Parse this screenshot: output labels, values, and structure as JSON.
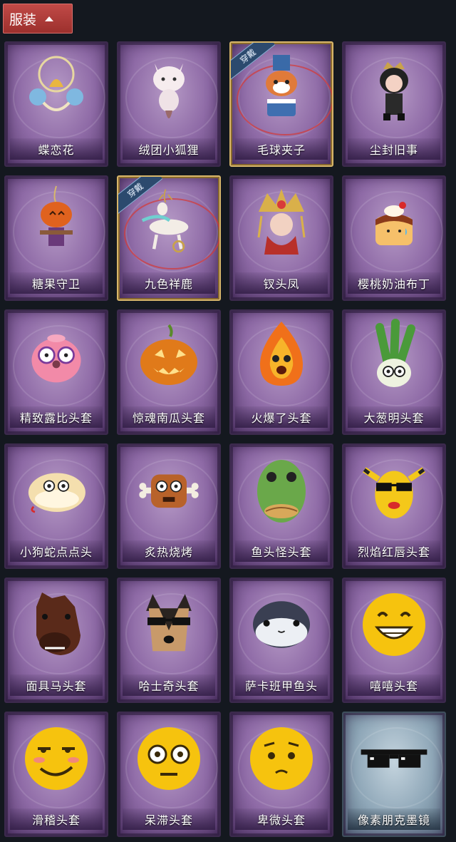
{
  "header": {
    "title": "服装"
  },
  "equipped_badge": "穿戴",
  "items": [
    {
      "name": "蝶恋花",
      "equipped": false,
      "icon": "ornament-bell-icon"
    },
    {
      "name": "绒团小狐狸",
      "equipped": false,
      "icon": "fox-plush-icon"
    },
    {
      "name": "毛球夹子",
      "equipped": true,
      "icon": "red-panda-drum-icon"
    },
    {
      "name": "尘封旧事",
      "equipped": false,
      "icon": "crowned-doll-icon"
    },
    {
      "name": "糖果守卫",
      "equipped": false,
      "icon": "pumpkin-scarecrow-icon"
    },
    {
      "name": "九色祥鹿",
      "equipped": true,
      "icon": "deer-pendant-icon"
    },
    {
      "name": "钗头凤",
      "equipped": false,
      "icon": "phoenix-crown-icon"
    },
    {
      "name": "樱桃奶油布丁",
      "equipped": false,
      "icon": "pudding-icon"
    },
    {
      "name": "精致露比头套",
      "equipped": false,
      "icon": "pink-beaver-mask-icon"
    },
    {
      "name": "惊魂南瓜头套",
      "equipped": false,
      "icon": "jack-o-lantern-icon"
    },
    {
      "name": "火爆了头套",
      "equipped": false,
      "icon": "fire-spirit-icon"
    },
    {
      "name": "大葱明头套",
      "equipped": false,
      "icon": "green-onion-icon"
    },
    {
      "name": "小狗蛇点点头",
      "equipped": false,
      "icon": "snake-dog-icon"
    },
    {
      "name": "炙热烧烤",
      "equipped": false,
      "icon": "meat-bone-icon"
    },
    {
      "name": "鱼头怪头套",
      "equipped": false,
      "icon": "fish-head-mask-icon"
    },
    {
      "name": "烈焰红唇头套",
      "equipped": false,
      "icon": "yellow-mask-sunglasses-icon"
    },
    {
      "name": "面具马头套",
      "equipped": false,
      "icon": "horse-head-icon"
    },
    {
      "name": "哈士奇头套",
      "equipped": false,
      "icon": "husky-sunglasses-icon"
    },
    {
      "name": "萨卡班甲鱼头",
      "equipped": false,
      "icon": "sacabambaspis-icon"
    },
    {
      "name": "嘻嘻头套",
      "equipped": false,
      "icon": "grin-emoji-icon"
    },
    {
      "name": "滑稽头套",
      "equipped": false,
      "icon": "smirk-emoji-icon"
    },
    {
      "name": "呆滞头套",
      "equipped": false,
      "icon": "dazed-emoji-icon"
    },
    {
      "name": "卑微头套",
      "equipped": false,
      "icon": "meek-emoji-icon"
    },
    {
      "name": "像素朋克墨镜",
      "equipped": false,
      "icon": "pixel-sunglasses-icon"
    }
  ]
}
